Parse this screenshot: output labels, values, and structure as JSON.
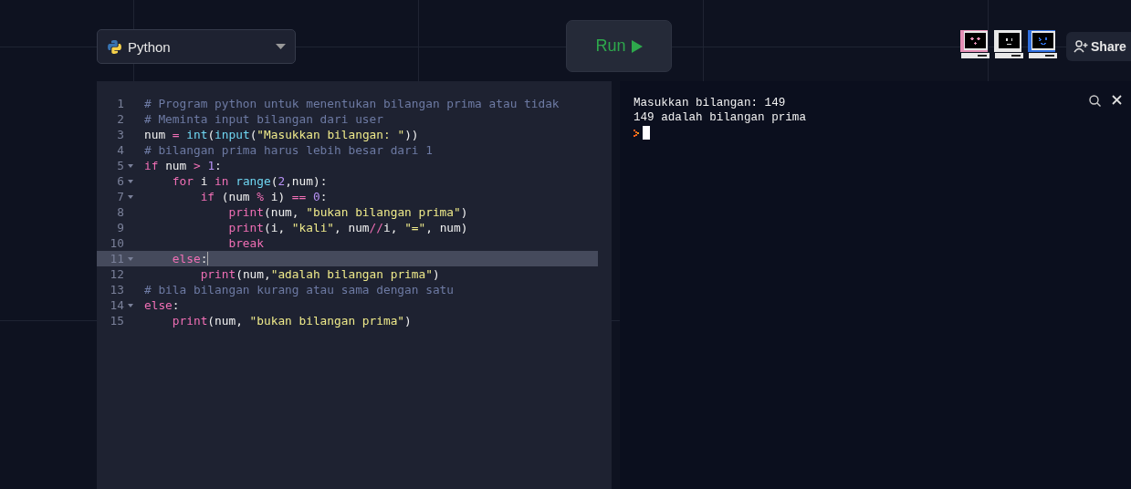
{
  "language_select": {
    "value": "Python"
  },
  "run_button": {
    "label": "Run"
  },
  "collaborators": [
    {
      "kind": "hearts",
      "color": "#e48fb5"
    },
    {
      "kind": "neutral",
      "color": "#e8e8e8"
    },
    {
      "kind": "wink",
      "color": "#2f6fe0"
    }
  ],
  "share_button": {
    "label": "Share"
  },
  "editor": {
    "lines": [
      {
        "number": "1",
        "foldable": false,
        "active": false,
        "tokens": [
          {
            "kind": "comment",
            "text": "# Program python untuk menentukan bilangan prima atau tidak"
          }
        ]
      },
      {
        "number": "2",
        "foldable": false,
        "active": false,
        "tokens": [
          {
            "kind": "comment",
            "text": "# Meminta input bilangan dari user"
          }
        ]
      },
      {
        "number": "3",
        "foldable": false,
        "active": false,
        "tokens": [
          {
            "kind": "plain",
            "text": "num "
          },
          {
            "kind": "operator",
            "text": "= "
          },
          {
            "kind": "builtin",
            "text": "int"
          },
          {
            "kind": "plain",
            "text": "("
          },
          {
            "kind": "builtin",
            "text": "input"
          },
          {
            "kind": "plain",
            "text": "("
          },
          {
            "kind": "string",
            "text": "\"Masukkan bilangan: \""
          },
          {
            "kind": "plain",
            "text": "))"
          }
        ]
      },
      {
        "number": "4",
        "foldable": false,
        "active": false,
        "tokens": [
          {
            "kind": "comment",
            "text": "# bilangan prima harus lebih besar dari 1"
          }
        ]
      },
      {
        "number": "5",
        "foldable": true,
        "active": false,
        "tokens": [
          {
            "kind": "keyword",
            "text": "if"
          },
          {
            "kind": "plain",
            "text": " num "
          },
          {
            "kind": "operator",
            "text": "> "
          },
          {
            "kind": "number",
            "text": "1"
          },
          {
            "kind": "plain",
            "text": ":"
          }
        ]
      },
      {
        "number": "6",
        "foldable": true,
        "active": false,
        "tokens": [
          {
            "kind": "keyword",
            "text": "    for"
          },
          {
            "kind": "plain",
            "text": " i "
          },
          {
            "kind": "keyword",
            "text": "in "
          },
          {
            "kind": "builtin",
            "text": "range"
          },
          {
            "kind": "plain",
            "text": "("
          },
          {
            "kind": "number",
            "text": "2"
          },
          {
            "kind": "plain",
            "text": ",num):"
          }
        ]
      },
      {
        "number": "7",
        "foldable": true,
        "active": false,
        "tokens": [
          {
            "kind": "keyword",
            "text": "        if"
          },
          {
            "kind": "plain",
            "text": " (num "
          },
          {
            "kind": "operator",
            "text": "%"
          },
          {
            "kind": "plain",
            "text": " i) "
          },
          {
            "kind": "operator",
            "text": "== "
          },
          {
            "kind": "number",
            "text": "0"
          },
          {
            "kind": "plain",
            "text": ":"
          }
        ]
      },
      {
        "number": "8",
        "foldable": false,
        "active": false,
        "tokens": [
          {
            "kind": "keyword",
            "text": "            print"
          },
          {
            "kind": "plain",
            "text": "(num, "
          },
          {
            "kind": "string",
            "text": "\"bukan bilangan prima\""
          },
          {
            "kind": "plain",
            "text": ")"
          }
        ]
      },
      {
        "number": "9",
        "foldable": false,
        "active": false,
        "tokens": [
          {
            "kind": "keyword",
            "text": "            print"
          },
          {
            "kind": "plain",
            "text": "(i, "
          },
          {
            "kind": "string",
            "text": "\"kali\""
          },
          {
            "kind": "plain",
            "text": ", num"
          },
          {
            "kind": "operator",
            "text": "//"
          },
          {
            "kind": "plain",
            "text": "i, "
          },
          {
            "kind": "string",
            "text": "\"=\""
          },
          {
            "kind": "plain",
            "text": ", num)"
          }
        ]
      },
      {
        "number": "10",
        "foldable": false,
        "active": false,
        "tokens": [
          {
            "kind": "keyword",
            "text": "            break"
          }
        ]
      },
      {
        "number": "11",
        "foldable": true,
        "active": true,
        "tokens": [
          {
            "kind": "keyword",
            "text": "    else"
          },
          {
            "kind": "plain",
            "text": ":"
          }
        ]
      },
      {
        "number": "12",
        "foldable": false,
        "active": false,
        "tokens": [
          {
            "kind": "keyword",
            "text": "        print"
          },
          {
            "kind": "plain",
            "text": "(num,"
          },
          {
            "kind": "string",
            "text": "\"adalah bilangan prima\""
          },
          {
            "kind": "plain",
            "text": ")"
          }
        ]
      },
      {
        "number": "13",
        "foldable": false,
        "active": false,
        "tokens": [
          {
            "kind": "comment",
            "text": "# bila bilangan kurang atau sama dengan satu"
          }
        ]
      },
      {
        "number": "14",
        "foldable": true,
        "active": false,
        "tokens": [
          {
            "kind": "keyword",
            "text": "else"
          },
          {
            "kind": "plain",
            "text": ":"
          }
        ]
      },
      {
        "number": "15",
        "foldable": false,
        "active": false,
        "tokens": [
          {
            "kind": "keyword",
            "text": "    print"
          },
          {
            "kind": "plain",
            "text": "(num, "
          },
          {
            "kind": "string",
            "text": "\"bukan bilangan prima\""
          },
          {
            "kind": "plain",
            "text": ")"
          }
        ]
      }
    ]
  },
  "console": {
    "lines": [
      "Masukkan bilangan: 149",
      "149 adalah bilangan prima"
    ]
  }
}
